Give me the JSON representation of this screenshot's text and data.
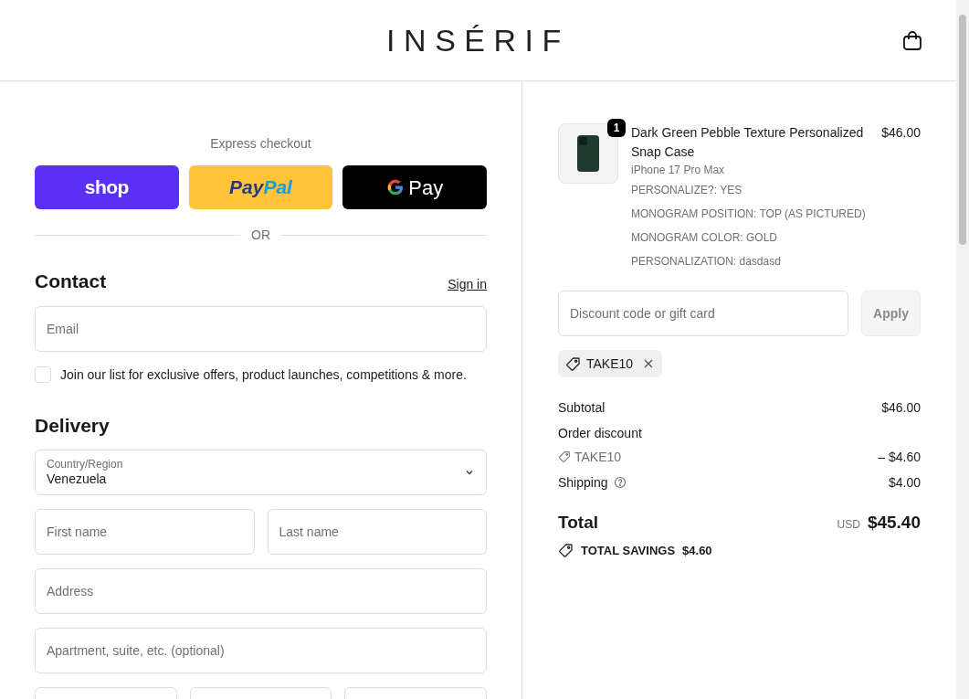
{
  "header": {
    "logo": "INSÉRIF"
  },
  "express": {
    "title": "Express checkout",
    "buttons": [
      {
        "kind": "shop",
        "label": "shop"
      },
      {
        "kind": "paypal",
        "label_a": "Pay",
        "label_b": "Pal"
      },
      {
        "kind": "gpay",
        "label": "Pay"
      }
    ],
    "divider": "OR"
  },
  "contact": {
    "heading": "Contact",
    "link": "Sign in",
    "email": {
      "placeholder": "Email"
    },
    "newsletter": {
      "label": "Join our list for exclusive offers, product launches, competitions & more.",
      "checked": false
    }
  },
  "delivery": {
    "heading": "Delivery",
    "country": {
      "label": "Country/Region",
      "value": "Venezuela"
    },
    "rows": [
      [
        {
          "kind": "input",
          "placeholder": "First name"
        },
        {
          "kind": "input",
          "placeholder": "Last name"
        }
      ],
      [
        {
          "kind": "input",
          "placeholder": "Address"
        }
      ],
      [
        {
          "kind": "input",
          "placeholder": "Apartment, suite, etc. (optional)"
        }
      ],
      [
        {
          "kind": "input"
        },
        {
          "kind": "input"
        },
        {
          "kind": "input"
        }
      ]
    ]
  },
  "item": {
    "quantity": "1",
    "title": "Dark Green Pebble Texture Personalized Snap Case",
    "price": "$46.00",
    "variant": "iPhone 17 Pro Max",
    "properties": [
      "PERSONALIZE?: YES",
      "MONOGRAM POSITION: TOP (AS PICTURED)",
      "MONOGRAM COLOR: GOLD",
      "PERSONALIZATION: dasdasd"
    ]
  },
  "discount": {
    "placeholder": "Discount code or gift card",
    "button": "Apply",
    "disabled": true,
    "applied": "TAKE10"
  },
  "summary": [
    {
      "kind": "plain",
      "label": "Subtotal",
      "value": "$46.00"
    },
    {
      "kind": "heading",
      "label": "Order discount"
    },
    {
      "kind": "code",
      "label": "TAKE10",
      "value": "– $4.60"
    },
    {
      "kind": "info",
      "label": "Shipping",
      "value": "$4.00"
    }
  ],
  "total": {
    "label": "Total",
    "currency": "USD",
    "amount": "$45.40"
  },
  "savings": {
    "label": "TOTAL SAVINGS",
    "amount": "$4.60"
  }
}
